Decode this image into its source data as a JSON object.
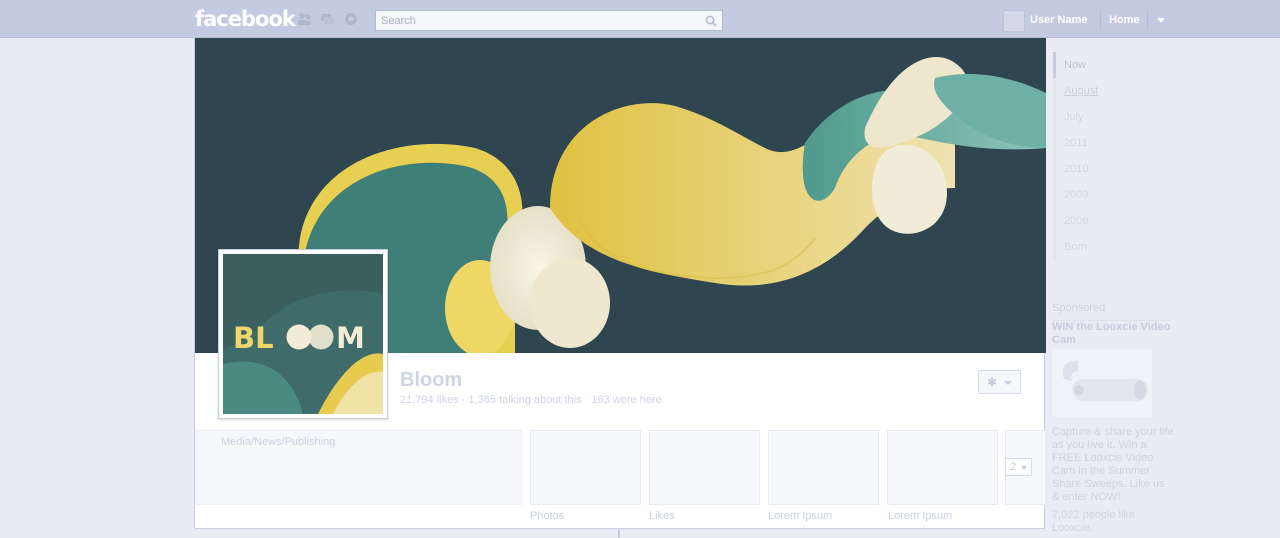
{
  "topbar": {
    "logo": "facebook",
    "search_placeholder": "Search",
    "user_name": "User Name",
    "home": "Home"
  },
  "page": {
    "name": "Bloom",
    "stats": "21,794 likes · 1,365 talking about this · 163 were here",
    "category": "Media/News/Publishing",
    "profile_logo": "BL◯◯M",
    "apps": [
      "Photos",
      "Likes",
      "Lorem Ipsum",
      "Lorem Ipsum"
    ],
    "more_count": "2"
  },
  "timeline": {
    "years": [
      "Now",
      "August",
      "July",
      "2011",
      "2010",
      "2009",
      "2008",
      "Born"
    ]
  },
  "sponsored": {
    "heading": "Sponsored",
    "ad_title": "WIN the Looxcie Video Cam",
    "ad_text": "Capture & share your life as you live it. Win a FREE Looxcie Video Cam in the Summer Share Sweeps. Like us & enter NOW!",
    "ad_likes": "7,022 people like Looxcie."
  },
  "colors": {
    "topbar": "#c3cbe0",
    "cover_bg": "#2f4550",
    "yellow": "#e7c84a",
    "teal": "#3f8c84",
    "cream": "#efe9d3"
  }
}
